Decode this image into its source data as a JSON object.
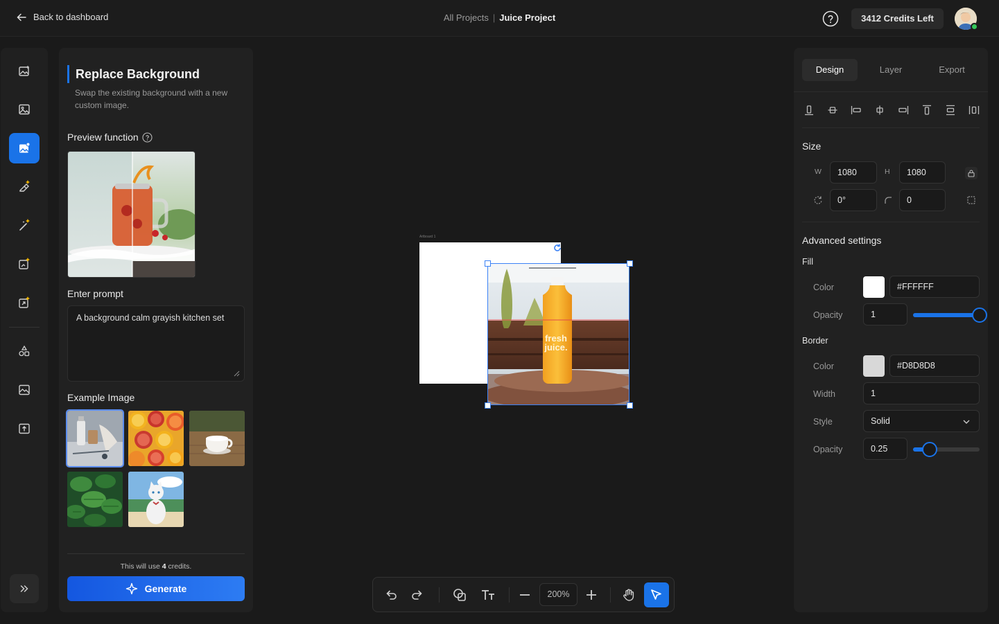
{
  "topbar": {
    "back_label": "Back to dashboard",
    "crumb_parent": "All Projects",
    "crumb_current": "Juice Project",
    "credits_label": "3412 Credits Left"
  },
  "left_panel": {
    "title": "Replace Background",
    "description": "Swap the existing background with a new custom image.",
    "preview_heading": "Preview function",
    "prompt_heading": "Enter prompt",
    "prompt_value": "A background calm grayish kitchen set",
    "examples_heading": "Example Image",
    "example_images": [
      "desk-items",
      "citrus-slices",
      "coffee-cup",
      "mint-leaves",
      "cartoon-cat"
    ],
    "credit_note_prefix": "This will use ",
    "credit_amount": "4",
    "credit_note_suffix": " credits.",
    "generate_label": "Generate"
  },
  "canvas": {
    "artboard_label": "Artboard 1",
    "product_text_line1": "fresh",
    "product_text_line2": "juice."
  },
  "toolbar": {
    "zoom": "200%"
  },
  "right_panel": {
    "tabs": [
      "Design",
      "Layer",
      "Export"
    ],
    "active_tab": "Design",
    "size_heading": "Size",
    "w_label": "W",
    "h_label": "H",
    "width": "1080",
    "height": "1080",
    "rotation": "0°",
    "radius": "0",
    "advanced_heading": "Advanced settings",
    "fill_heading": "Fill",
    "fill_color_label": "Color",
    "fill_color": "#FFFFFF",
    "fill_opacity_label": "Opacity",
    "fill_opacity": "1",
    "fill_opacity_fraction": 1.0,
    "border_heading": "Border",
    "border_color_label": "Color",
    "border_color": "#D8D8D8",
    "border_width_label": "Width",
    "border_width": "1",
    "border_style_label": "Style",
    "border_style": "Solid",
    "border_opacity_label": "Opacity",
    "border_opacity": "0.25",
    "border_opacity_fraction": 0.25
  },
  "colors": {
    "accent": "#1A73E8",
    "status_online": "#34C759"
  }
}
